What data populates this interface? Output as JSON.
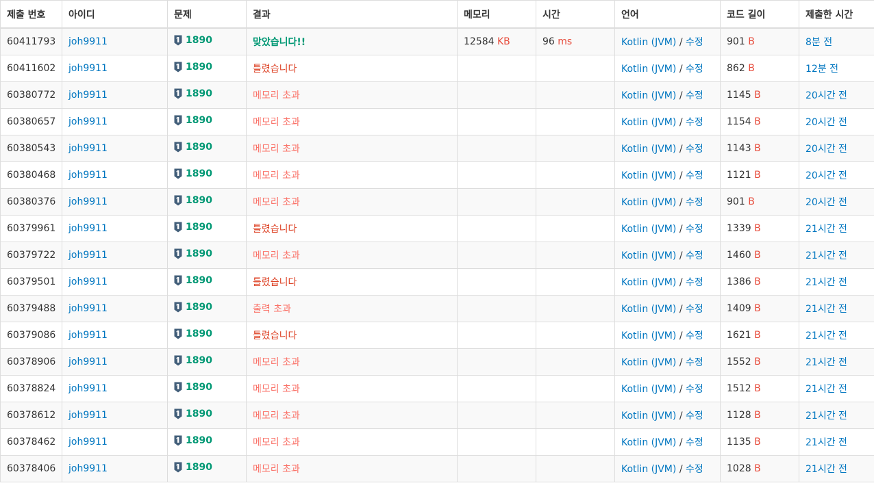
{
  "colors": {
    "link": "#0076c0",
    "accepted": "#009874",
    "wrong": "#dd4124",
    "limit": "#fa7268",
    "unit": "#e74c3c",
    "tier_icon": "#435f7a"
  },
  "headers": [
    "제출 번호",
    "아이디",
    "문제",
    "결과",
    "메모리",
    "시간",
    "언어",
    "코드 길이",
    "제출한 시간"
  ],
  "rows": [
    {
      "id": "60411793",
      "user": "joh9911",
      "tier_icon": "tier-badge-icon",
      "problem": "1890",
      "result": "맞았습니다!!",
      "result_type": "ac",
      "memory": "12584",
      "memory_unit": "KB",
      "time": "96",
      "time_unit": "ms",
      "lang": "Kotlin (JVM)",
      "sep": "/",
      "edit": "수정",
      "length": "901",
      "length_unit": "B",
      "submitted": "8분 전"
    },
    {
      "id": "60411602",
      "user": "joh9911",
      "tier_icon": "tier-badge-icon",
      "problem": "1890",
      "result": "틀렸습니다",
      "result_type": "wa",
      "memory": "",
      "memory_unit": "",
      "time": "",
      "time_unit": "",
      "lang": "Kotlin (JVM)",
      "sep": "/",
      "edit": "수정",
      "length": "862",
      "length_unit": "B",
      "submitted": "12분 전"
    },
    {
      "id": "60380772",
      "user": "joh9911",
      "tier_icon": "tier-badge-icon",
      "problem": "1890",
      "result": "메모리 초과",
      "result_type": "mle",
      "memory": "",
      "memory_unit": "",
      "time": "",
      "time_unit": "",
      "lang": "Kotlin (JVM)",
      "sep": "/",
      "edit": "수정",
      "length": "1145",
      "length_unit": "B",
      "submitted": "20시간 전"
    },
    {
      "id": "60380657",
      "user": "joh9911",
      "tier_icon": "tier-badge-icon",
      "problem": "1890",
      "result": "메모리 초과",
      "result_type": "mle",
      "memory": "",
      "memory_unit": "",
      "time": "",
      "time_unit": "",
      "lang": "Kotlin (JVM)",
      "sep": "/",
      "edit": "수정",
      "length": "1154",
      "length_unit": "B",
      "submitted": "20시간 전"
    },
    {
      "id": "60380543",
      "user": "joh9911",
      "tier_icon": "tier-badge-icon",
      "problem": "1890",
      "result": "메모리 초과",
      "result_type": "mle",
      "memory": "",
      "memory_unit": "",
      "time": "",
      "time_unit": "",
      "lang": "Kotlin (JVM)",
      "sep": "/",
      "edit": "수정",
      "length": "1143",
      "length_unit": "B",
      "submitted": "20시간 전"
    },
    {
      "id": "60380468",
      "user": "joh9911",
      "tier_icon": "tier-badge-icon",
      "problem": "1890",
      "result": "메모리 초과",
      "result_type": "mle",
      "memory": "",
      "memory_unit": "",
      "time": "",
      "time_unit": "",
      "lang": "Kotlin (JVM)",
      "sep": "/",
      "edit": "수정",
      "length": "1121",
      "length_unit": "B",
      "submitted": "20시간 전"
    },
    {
      "id": "60380376",
      "user": "joh9911",
      "tier_icon": "tier-badge-icon",
      "problem": "1890",
      "result": "메모리 초과",
      "result_type": "mle",
      "memory": "",
      "memory_unit": "",
      "time": "",
      "time_unit": "",
      "lang": "Kotlin (JVM)",
      "sep": "/",
      "edit": "수정",
      "length": "901",
      "length_unit": "B",
      "submitted": "20시간 전"
    },
    {
      "id": "60379961",
      "user": "joh9911",
      "tier_icon": "tier-badge-icon",
      "problem": "1890",
      "result": "틀렸습니다",
      "result_type": "wa",
      "memory": "",
      "memory_unit": "",
      "time": "",
      "time_unit": "",
      "lang": "Kotlin (JVM)",
      "sep": "/",
      "edit": "수정",
      "length": "1339",
      "length_unit": "B",
      "submitted": "21시간 전"
    },
    {
      "id": "60379722",
      "user": "joh9911",
      "tier_icon": "tier-badge-icon",
      "problem": "1890",
      "result": "메모리 초과",
      "result_type": "mle",
      "memory": "",
      "memory_unit": "",
      "time": "",
      "time_unit": "",
      "lang": "Kotlin (JVM)",
      "sep": "/",
      "edit": "수정",
      "length": "1460",
      "length_unit": "B",
      "submitted": "21시간 전"
    },
    {
      "id": "60379501",
      "user": "joh9911",
      "tier_icon": "tier-badge-icon",
      "problem": "1890",
      "result": "틀렸습니다",
      "result_type": "wa",
      "memory": "",
      "memory_unit": "",
      "time": "",
      "time_unit": "",
      "lang": "Kotlin (JVM)",
      "sep": "/",
      "edit": "수정",
      "length": "1386",
      "length_unit": "B",
      "submitted": "21시간 전"
    },
    {
      "id": "60379488",
      "user": "joh9911",
      "tier_icon": "tier-badge-icon",
      "problem": "1890",
      "result": "출력 초과",
      "result_type": "ole",
      "memory": "",
      "memory_unit": "",
      "time": "",
      "time_unit": "",
      "lang": "Kotlin (JVM)",
      "sep": "/",
      "edit": "수정",
      "length": "1409",
      "length_unit": "B",
      "submitted": "21시간 전"
    },
    {
      "id": "60379086",
      "user": "joh9911",
      "tier_icon": "tier-badge-icon",
      "problem": "1890",
      "result": "틀렸습니다",
      "result_type": "wa",
      "memory": "",
      "memory_unit": "",
      "time": "",
      "time_unit": "",
      "lang": "Kotlin (JVM)",
      "sep": "/",
      "edit": "수정",
      "length": "1621",
      "length_unit": "B",
      "submitted": "21시간 전"
    },
    {
      "id": "60378906",
      "user": "joh9911",
      "tier_icon": "tier-badge-icon",
      "problem": "1890",
      "result": "메모리 초과",
      "result_type": "mle",
      "memory": "",
      "memory_unit": "",
      "time": "",
      "time_unit": "",
      "lang": "Kotlin (JVM)",
      "sep": "/",
      "edit": "수정",
      "length": "1552",
      "length_unit": "B",
      "submitted": "21시간 전"
    },
    {
      "id": "60378824",
      "user": "joh9911",
      "tier_icon": "tier-badge-icon",
      "problem": "1890",
      "result": "메모리 초과",
      "result_type": "mle",
      "memory": "",
      "memory_unit": "",
      "time": "",
      "time_unit": "",
      "lang": "Kotlin (JVM)",
      "sep": "/",
      "edit": "수정",
      "length": "1512",
      "length_unit": "B",
      "submitted": "21시간 전"
    },
    {
      "id": "60378612",
      "user": "joh9911",
      "tier_icon": "tier-badge-icon",
      "problem": "1890",
      "result": "메모리 초과",
      "result_type": "mle",
      "memory": "",
      "memory_unit": "",
      "time": "",
      "time_unit": "",
      "lang": "Kotlin (JVM)",
      "sep": "/",
      "edit": "수정",
      "length": "1128",
      "length_unit": "B",
      "submitted": "21시간 전"
    },
    {
      "id": "60378462",
      "user": "joh9911",
      "tier_icon": "tier-badge-icon",
      "problem": "1890",
      "result": "메모리 초과",
      "result_type": "mle",
      "memory": "",
      "memory_unit": "",
      "time": "",
      "time_unit": "",
      "lang": "Kotlin (JVM)",
      "sep": "/",
      "edit": "수정",
      "length": "1135",
      "length_unit": "B",
      "submitted": "21시간 전"
    },
    {
      "id": "60378406",
      "user": "joh9911",
      "tier_icon": "tier-badge-icon",
      "problem": "1890",
      "result": "메모리 초과",
      "result_type": "mle",
      "memory": "",
      "memory_unit": "",
      "time": "",
      "time_unit": "",
      "lang": "Kotlin (JVM)",
      "sep": "/",
      "edit": "수정",
      "length": "1028",
      "length_unit": "B",
      "submitted": "21시간 전"
    }
  ]
}
